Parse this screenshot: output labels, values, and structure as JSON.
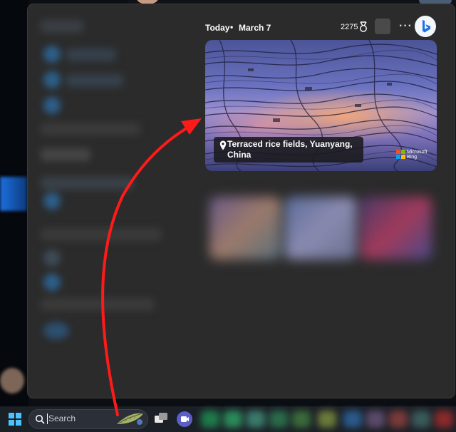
{
  "widgets": {
    "header": {
      "today_label": "Today",
      "separator": "•",
      "date": "March 7",
      "reward_points": "2275",
      "reward_icon": "rewards-medal-icon",
      "more_label": "···",
      "bing_icon": "bing-icon"
    },
    "hero": {
      "caption": "Terraced rice fields, Yuanyang, China",
      "location_icon": "location-pin-icon",
      "brand_line1": "Microsoft",
      "brand_line2": "Bing"
    }
  },
  "taskbar": {
    "start_icon": "windows-start-icon",
    "search_placeholder": "Search",
    "search_icon": "search-icon",
    "apps": [
      "task-view-icon",
      "teams-chat-icon"
    ]
  },
  "annotation": {
    "color": "#ff1a1a"
  },
  "colors": {
    "panel": "#2b2b2b",
    "taskbar": "#1b1f26",
    "accent": "#4cc2ff"
  }
}
